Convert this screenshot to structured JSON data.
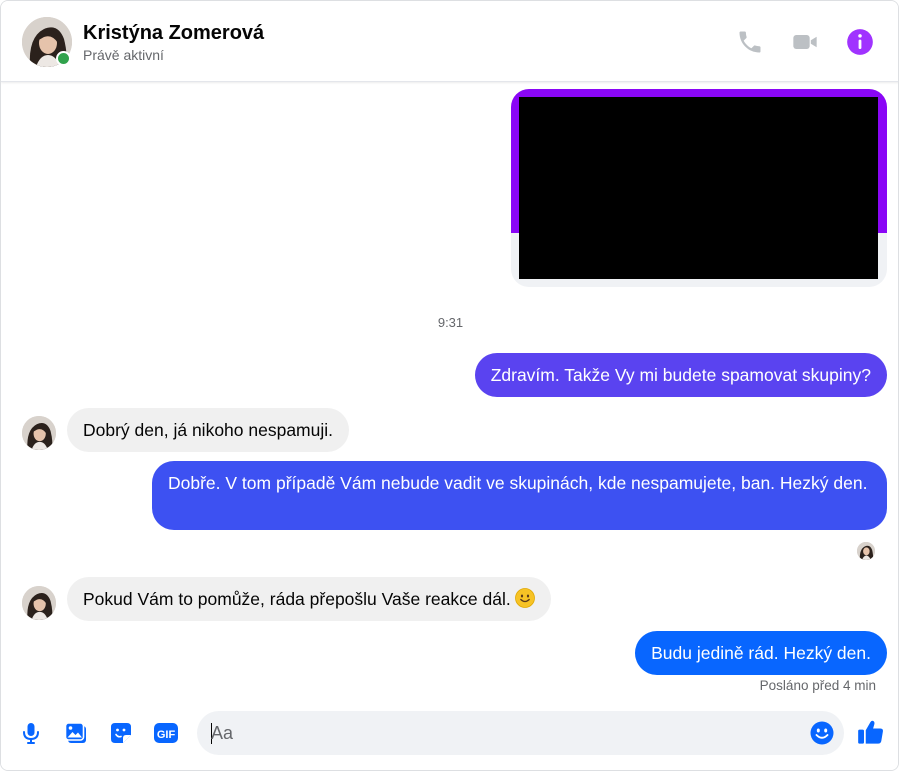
{
  "header": {
    "contact_name": "Kristýna Zomerová",
    "status": "Právě aktivní",
    "icons": [
      "phone-icon",
      "video-call-icon",
      "info-icon"
    ]
  },
  "colors": {
    "accent": "#a033ff",
    "icon_gray": "#bcc0c4",
    "online": "#31a24c",
    "blue": "#0866ff"
  },
  "thread": {
    "timestamp": "9:31",
    "messages": [
      {
        "from": "me",
        "text": "Zdravím. Takže Vy mi budete spamovat skupiny?"
      },
      {
        "from": "contact",
        "text": "Dobrý den, já nikoho nespamuji."
      },
      {
        "from": "me",
        "text": "Dobře. V tom případě Vám nebude vadit ve skupinách, kde nespamujete, ban. Hezký den."
      },
      {
        "from": "contact",
        "text": "Pokud Vám to pomůže, ráda přepošlu Vaše reakce dál.",
        "emoji": "slightly-smiling-face"
      },
      {
        "from": "me",
        "text": "Budu jedině rád. Hezký den."
      }
    ],
    "sent_status": "Posláno před 4 min"
  },
  "composer": {
    "placeholder": "Aa",
    "icons": [
      "microphone-icon",
      "photo-icon",
      "sticker-icon",
      "gif-icon",
      "emoji-icon",
      "like-icon"
    ],
    "gif_label": "GIF"
  }
}
